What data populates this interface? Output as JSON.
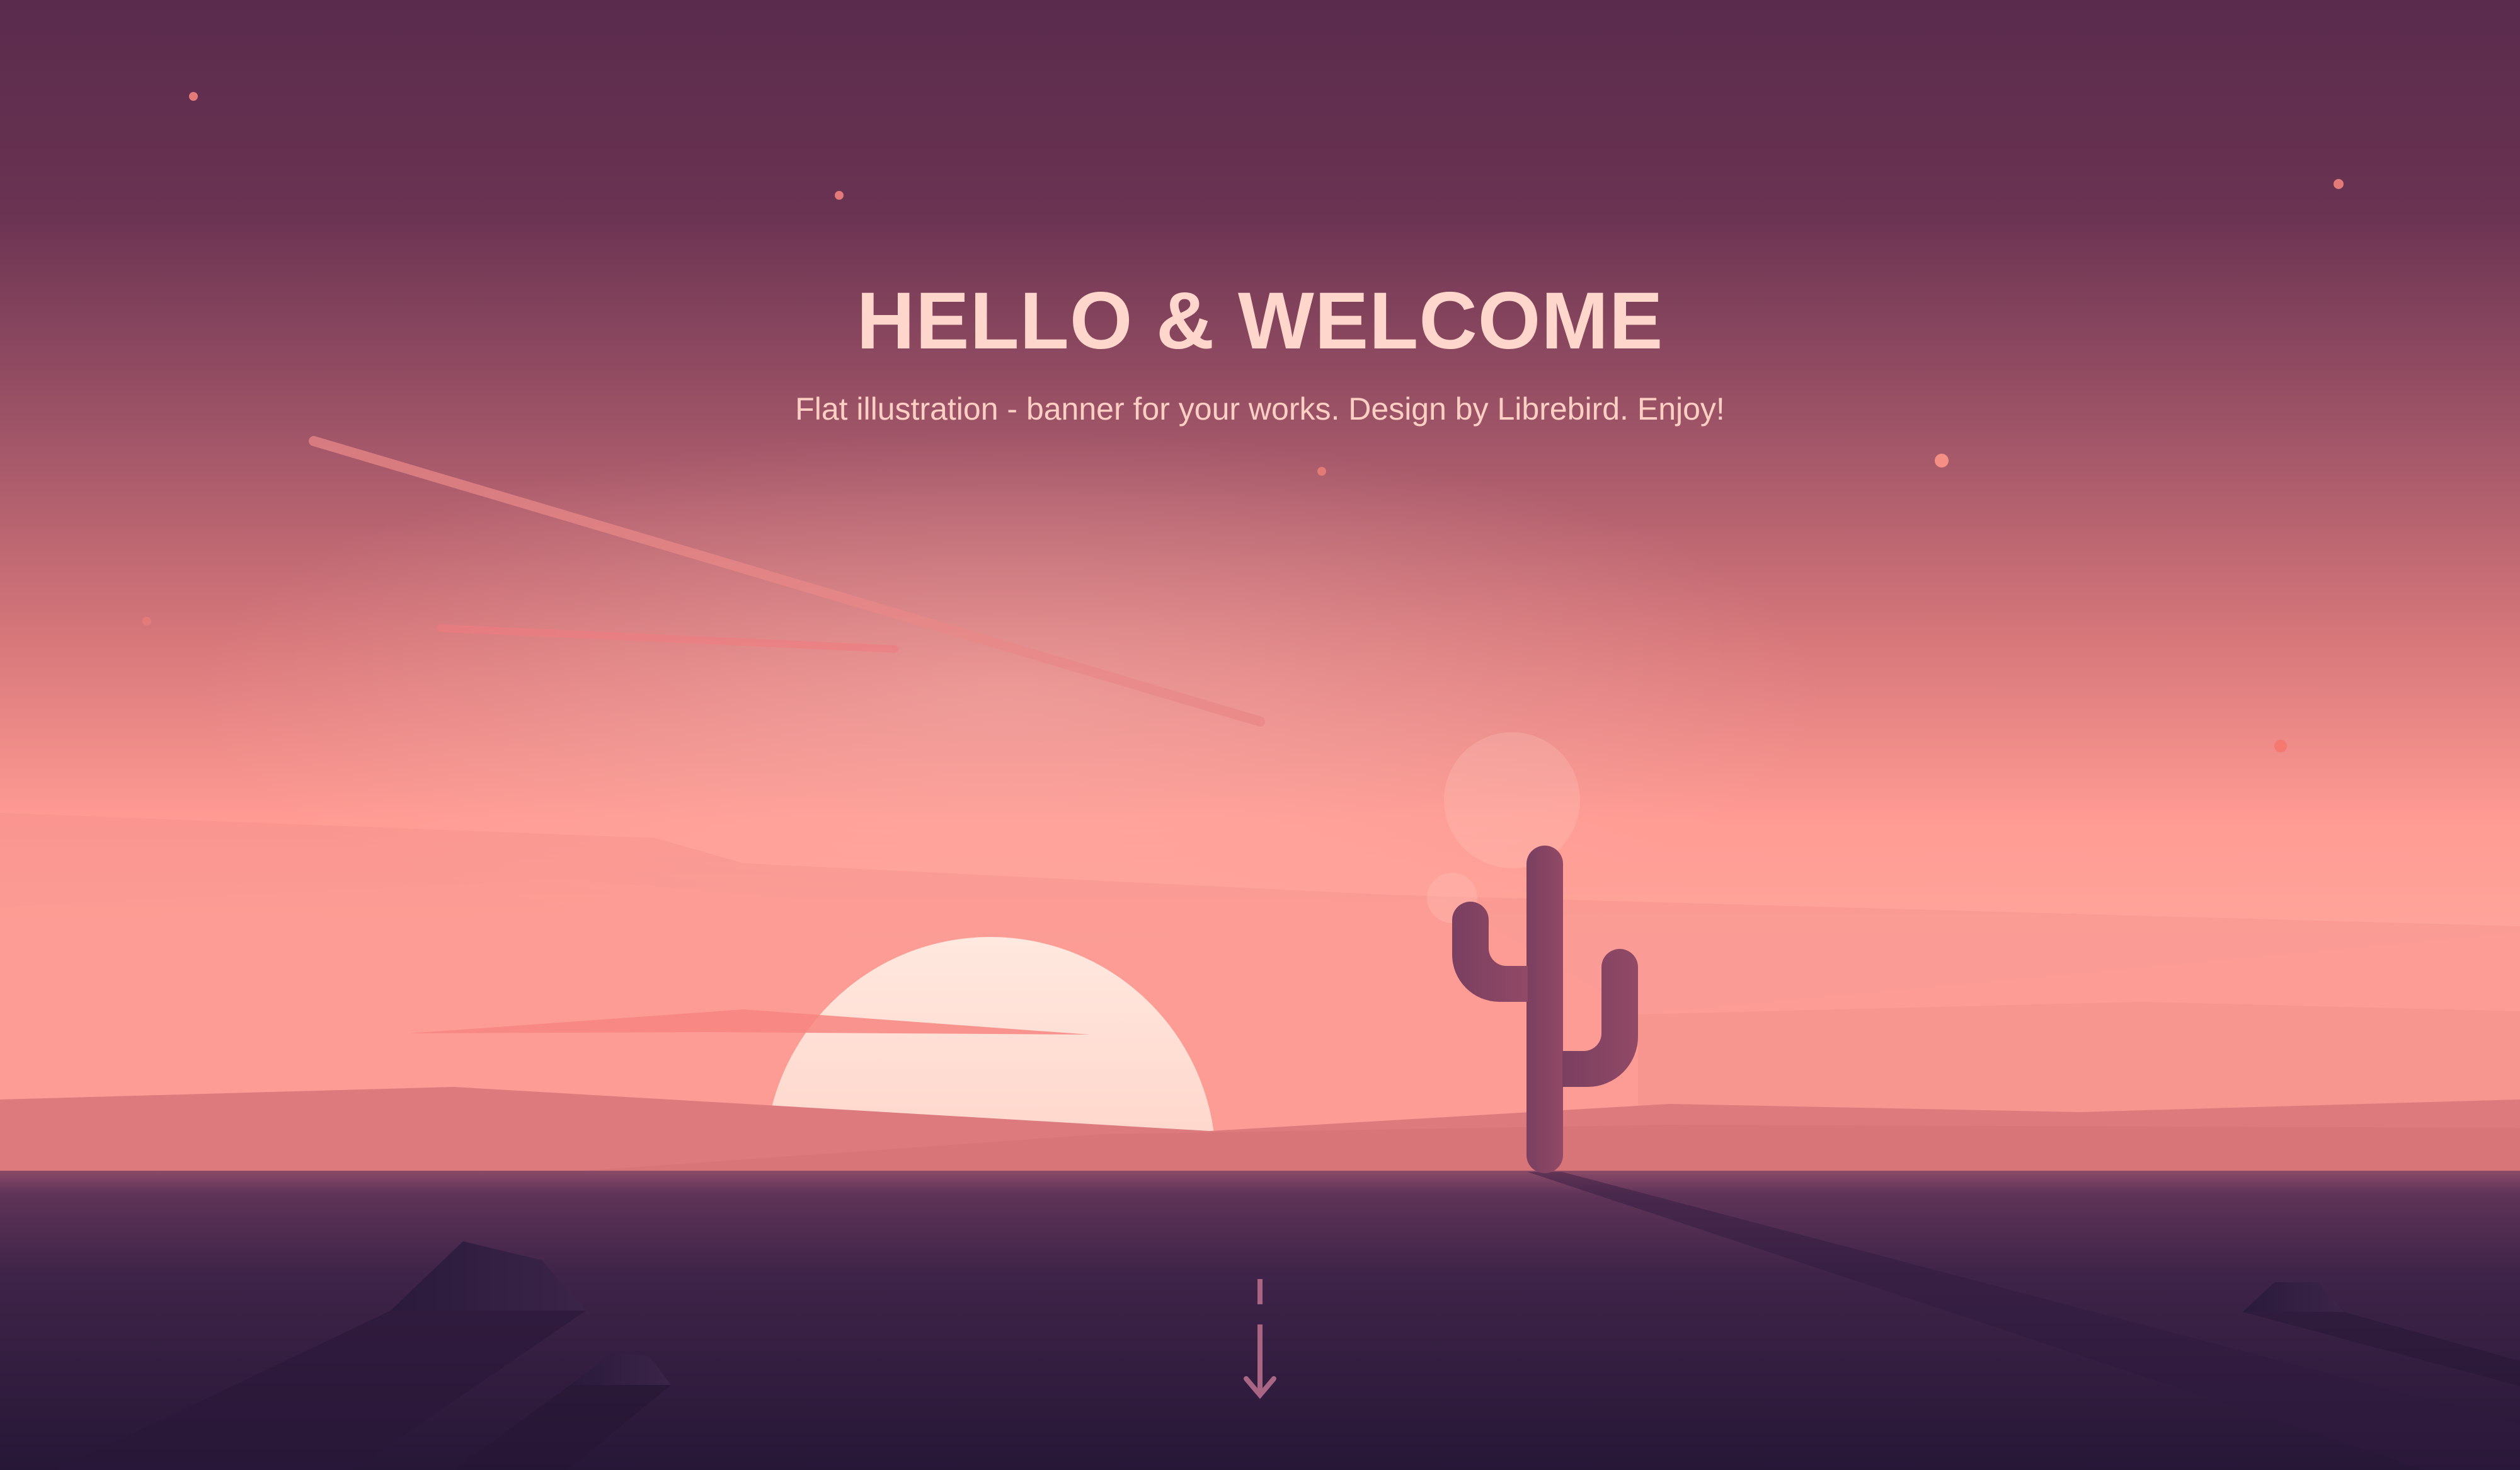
{
  "hero": {
    "title": "HELLO & WELCOME",
    "subtitle": "Flat illustration - banner for your works. Design by Librebird. Enjoy!"
  },
  "scene": {
    "sky_top_color": "#5a2b4d",
    "sky_mid_color": "#b7616f",
    "horizon_color": "#ff9f96",
    "ground_color": "#2c1a3d",
    "sun_color": "#ffe5dc",
    "cactus_color": "#7a3f5e",
    "text_color": "#ffd6cb"
  },
  "scroll_indicator": {
    "icon": "arrow-down-icon"
  }
}
